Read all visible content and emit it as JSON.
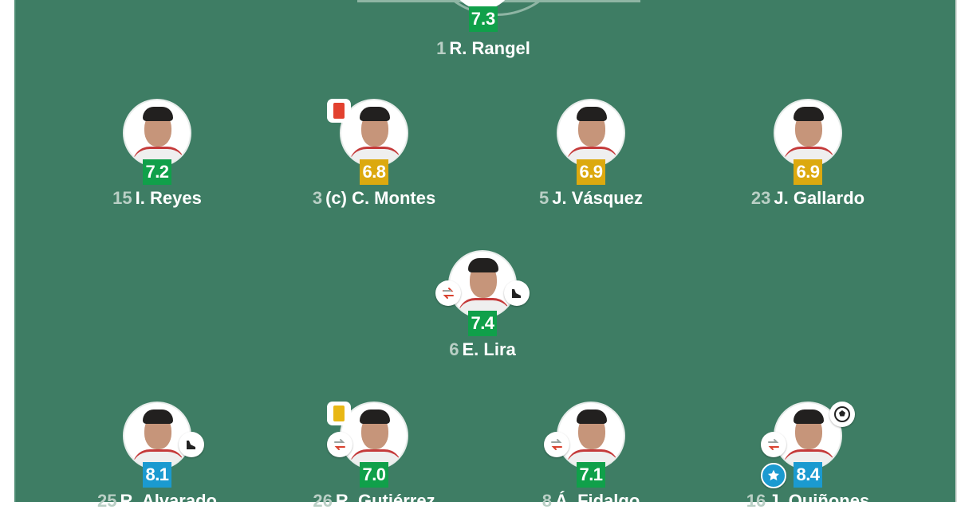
{
  "colors": {
    "pitch": "#3e7d64",
    "rating_green": "#10a04a",
    "rating_yellow": "#dca90f",
    "rating_blue": "#1b9ad0",
    "red_card": "#e2412f",
    "yellow_card": "#e8b714",
    "sub_icon": "#d9422f"
  },
  "goalkeeper": {
    "number": "1",
    "name": "R. Rangel",
    "rating": "7.3",
    "rating_color": "green"
  },
  "defenders": [
    {
      "number": "15",
      "name": "I. Reyes",
      "rating": "7.2",
      "rating_color": "green"
    },
    {
      "number": "3",
      "name": "(c) C. Montes",
      "rating": "6.8",
      "rating_color": "yellow",
      "badges": [
        "red-card"
      ]
    },
    {
      "number": "5",
      "name": "J. Vásquez",
      "rating": "6.9",
      "rating_color": "yellow"
    },
    {
      "number": "23",
      "name": "J. Gallardo",
      "rating": "6.9",
      "rating_color": "yellow"
    }
  ],
  "midfield_holding": [
    {
      "number": "6",
      "name": "E. Lira",
      "rating": "7.4",
      "rating_color": "green",
      "badges": [
        "substitution",
        "assist"
      ]
    }
  ],
  "attack": [
    {
      "number": "25",
      "name": "R. Alvarado",
      "rating": "8.1",
      "rating_color": "blue",
      "badges": [
        "assist"
      ]
    },
    {
      "number": "26",
      "name": "R. Gutiérrez",
      "rating": "7.0",
      "rating_color": "green",
      "badges": [
        "yellow-card",
        "substitution"
      ]
    },
    {
      "number": "8",
      "name": "Á. Fidalgo",
      "rating": "7.1",
      "rating_color": "green",
      "badges": [
        "substitution"
      ]
    },
    {
      "number": "16",
      "name": "J. Quiñones",
      "rating": "8.4",
      "rating_color": "blue",
      "badges": [
        "goal",
        "substitution",
        "player-of-match"
      ]
    }
  ]
}
